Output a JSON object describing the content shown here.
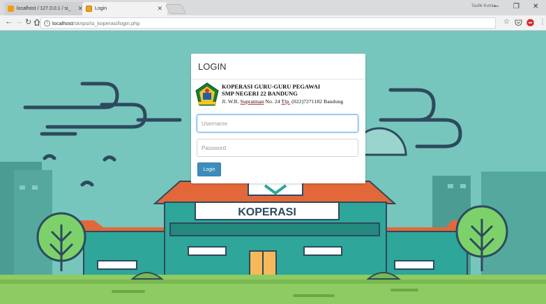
{
  "browser": {
    "tabs": [
      {
        "label": "localhost / 127.0.0.1 / si_",
        "favicon_color": "#f39c12",
        "active": false
      },
      {
        "label": "Login",
        "favicon_color": "#f0a020",
        "active": true
      }
    ],
    "user_badge": "Taufik Kurnia",
    "address_host": "localhost",
    "address_path": "/skripsi/si_koperasi/login.php"
  },
  "background": {
    "building_sign": "KOPERASI"
  },
  "login": {
    "header": "LOGIN",
    "school": {
      "name_line1": "KOPERASI GURU-GURU PEGAWAI",
      "name_line2": "SMP NEGERI 22 BANDUNG",
      "addr_prefix": "Jl. W.R. ",
      "addr_street": "Supratman",
      "addr_mid": " No. 24 ",
      "addr_tlp": "Tlp.",
      "addr_rest": " (022)7271182 Bandung"
    },
    "username_placeholder": "Username",
    "password_placeholder": "Password",
    "button_label": "Login"
  },
  "colors": {
    "sky": "#77c6bd",
    "building": "#2ea69a",
    "roof": "#e2683a",
    "button": "#3c8dbc"
  }
}
